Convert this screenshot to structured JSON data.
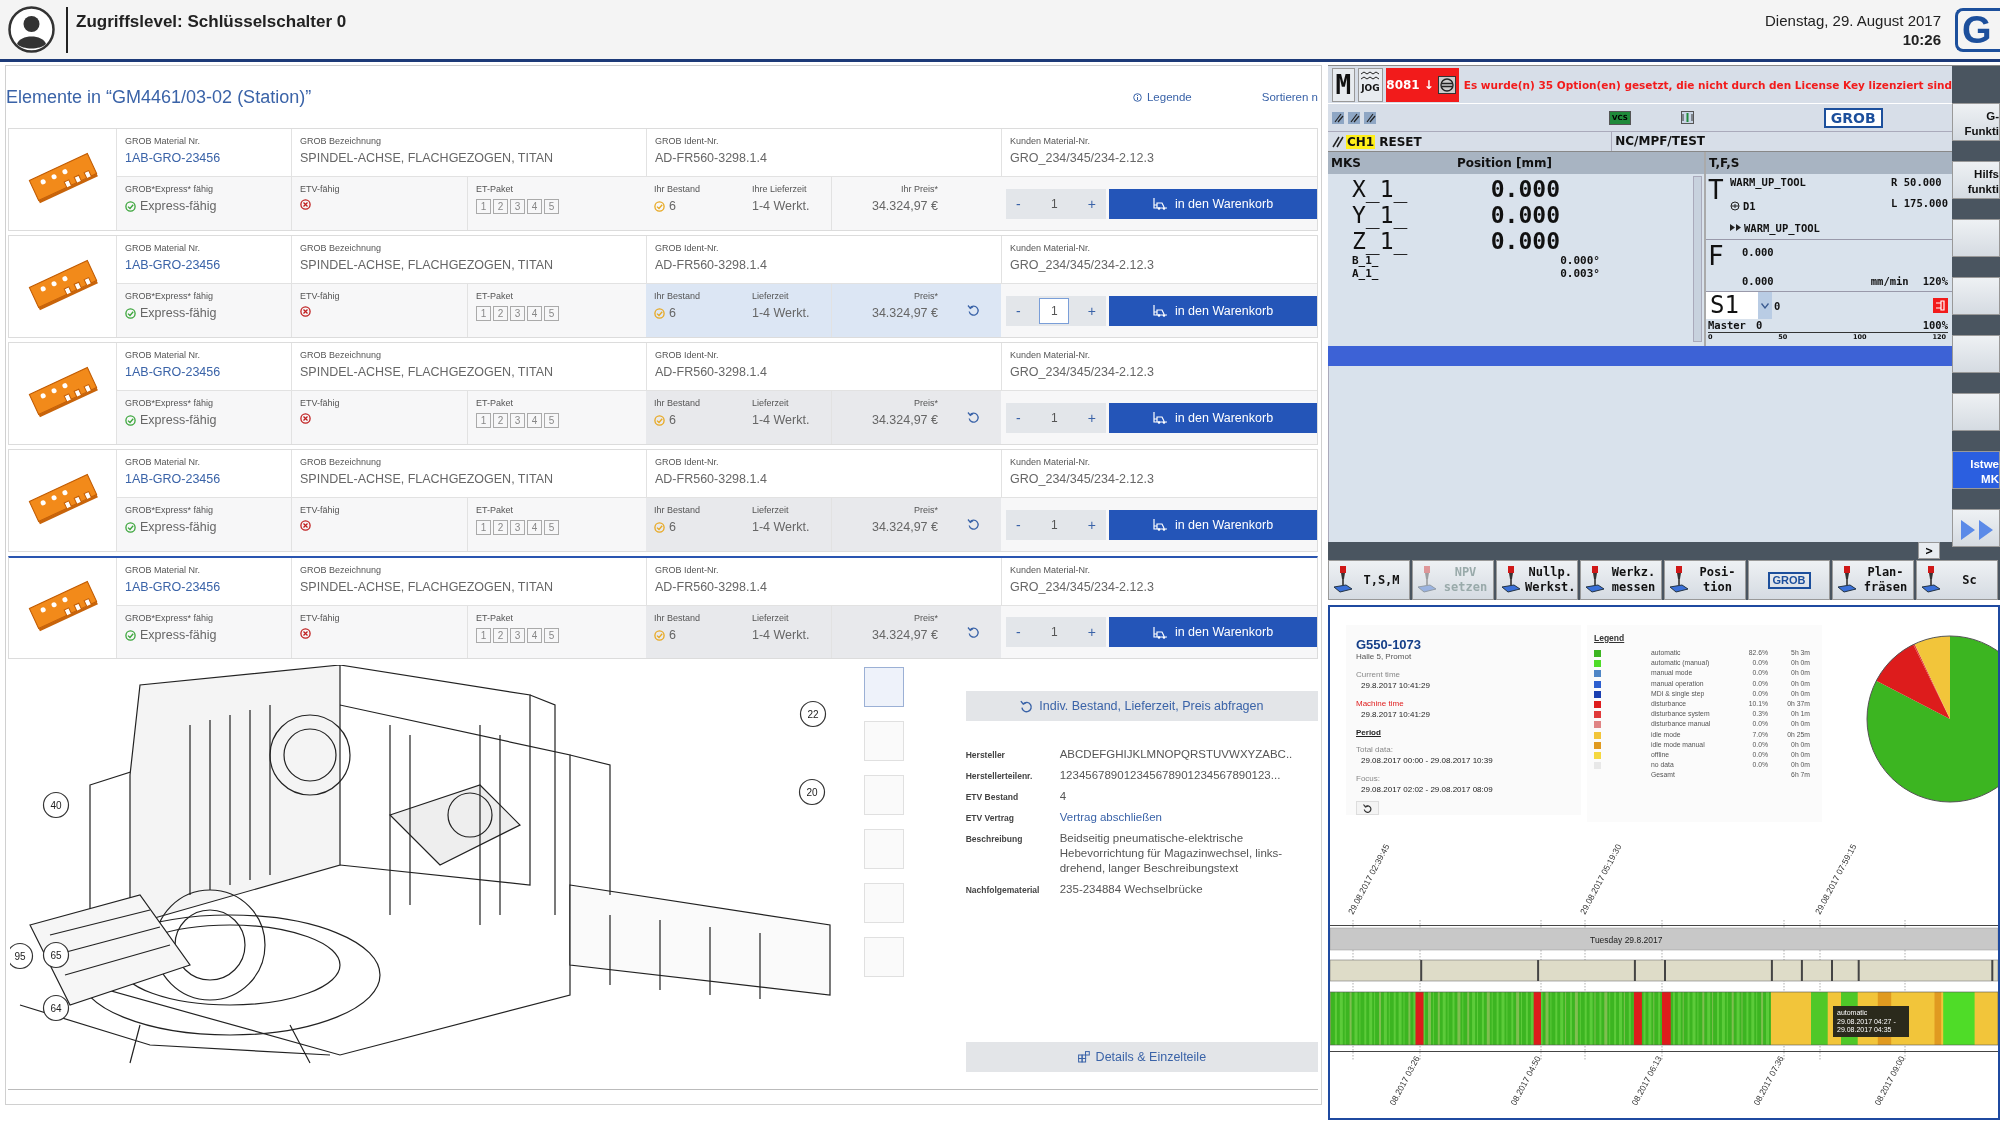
{
  "header": {
    "access_level": "Zugriffslevel: Schlüsselschalter 0",
    "date": "Dienstag, 29. August 2017",
    "time": "10:26",
    "logo": "G"
  },
  "catalog": {
    "title": "Elemente in “GM4461/03-02 (Station)”",
    "legend_link": "Legende",
    "sort_link": "Sortieren n",
    "rows": [
      {
        "kind": "own",
        "highlighted": false,
        "selected": false,
        "material_label": "GROB Material Nr.",
        "material": "1AB-GRO-23456",
        "name_label": "GROB Bezeichnung",
        "name": "SPINDEL-ACHSE, FLACHGEZOGEN, TITAN",
        "ident_label": "GROB Ident-Nr.",
        "ident": "AD-FR560-3298.1.4",
        "customer_label": "Kunden Material-Nr.",
        "customer": "GRO_234/345/234-2.12.3",
        "express_label": "GROB*Express* fähig",
        "express": "Express-fähig",
        "etv_label": "ETV-fähig",
        "etv": false,
        "package_label": "ET-Paket",
        "packages": [
          "1",
          "2",
          "3",
          "4",
          "5"
        ],
        "stock_label": "Ihr Bestand",
        "stock": "6",
        "delivery_label": "Ihre Lieferzeit",
        "delivery": "1-4 Werkt.",
        "price_label": "Ihr Preis*",
        "price": "34.324,97 €",
        "minus": "-",
        "quantity": "1",
        "plus": "+",
        "cart": "in den Warenkorb"
      },
      {
        "kind": "queried",
        "highlighted": true,
        "selected": false,
        "material_label": "GROB Material Nr.",
        "material": "1AB-GRO-23456",
        "name_label": "GROB Bezeichnung",
        "name": "SPINDEL-ACHSE, FLACHGEZOGEN, TITAN",
        "ident_label": "GROB Ident-Nr.",
        "ident": "AD-FR560-3298.1.4",
        "customer_label": "Kunden Material-Nr.",
        "customer": "GRO_234/345/234-2.12.3",
        "express_label": "GROB*Express* fähig",
        "express": "Express-fähig",
        "etv_label": "ETV-fähig",
        "etv": false,
        "package_label": "ET-Paket",
        "packages": [
          "1",
          "2",
          "3",
          "4",
          "5"
        ],
        "stock_label": "Ihr Bestand",
        "stock": "6",
        "delivery_label": "Lieferzeit",
        "delivery": "1-4 Werkt.",
        "price_label": "Preis*",
        "price": "34.324,97 €",
        "minus": "-",
        "quantity": "1",
        "plus": "+",
        "cart": "in den Warenkorb"
      },
      {
        "kind": "queried",
        "highlighted": false,
        "selected": false,
        "material_label": "GROB Material Nr.",
        "material": "1AB-GRO-23456",
        "name_label": "GROB Bezeichnung",
        "name": "SPINDEL-ACHSE, FLACHGEZOGEN, TITAN",
        "ident_label": "GROB Ident-Nr.",
        "ident": "AD-FR560-3298.1.4",
        "customer_label": "Kunden Material-Nr.",
        "customer": "GRO_234/345/234-2.12.3",
        "express_label": "GROB*Express* fähig",
        "express": "Express-fähig",
        "etv_label": "ETV-fähig",
        "etv": false,
        "package_label": "ET-Paket",
        "packages": [
          "1",
          "2",
          "3",
          "4",
          "5"
        ],
        "stock_label": "Ihr Bestand",
        "stock": "6",
        "delivery_label": "Lieferzeit",
        "delivery": "1-4 Werkt.",
        "price_label": "Preis*",
        "price": "34.324,97 €",
        "minus": "-",
        "quantity": "1",
        "plus": "+",
        "cart": "in den Warenkorb"
      },
      {
        "kind": "queried",
        "highlighted": false,
        "selected": false,
        "material_label": "GROB Material Nr.",
        "material": "1AB-GRO-23456",
        "name_label": "GROB Bezeichnung",
        "name": "SPINDEL-ACHSE, FLACHGEZOGEN, TITAN",
        "ident_label": "GROB Ident-Nr.",
        "ident": "AD-FR560-3298.1.4",
        "customer_label": "Kunden Material-Nr.",
        "customer": "GRO_234/345/234-2.12.3",
        "express_label": "GROB*Express* fähig",
        "express": "Express-fähig",
        "etv_label": "ETV-fähig",
        "etv": false,
        "package_label": "ET-Paket",
        "packages": [
          "1",
          "2",
          "3",
          "4",
          "5"
        ],
        "stock_label": "Ihr Bestand",
        "stock": "6",
        "delivery_label": "Lieferzeit",
        "delivery": "1-4 Werkt.",
        "price_label": "Preis*",
        "price": "34.324,97 €",
        "minus": "-",
        "quantity": "1",
        "plus": "+",
        "cart": "in den Warenkorb"
      },
      {
        "kind": "queried",
        "highlighted": false,
        "selected": true,
        "material_label": "GROB Material Nr.",
        "material": "1AB-GRO-23456",
        "name_label": "GROB Bezeichnung",
        "name": "SPINDEL-ACHSE, FLACHGEZOGEN, TITAN",
        "ident_label": "GROB Ident-Nr.",
        "ident": "AD-FR560-3298.1.4",
        "customer_label": "Kunden Material-Nr.",
        "customer": "GRO_234/345/234-2.12.3",
        "express_label": "GROB*Express* fähig",
        "express": "Express-fähig",
        "etv_label": "ETV-fähig",
        "etv": false,
        "package_label": "ET-Paket",
        "packages": [
          "1",
          "2",
          "3",
          "4",
          "5"
        ],
        "stock_label": "Ihr Bestand",
        "stock": "6",
        "delivery_label": "Lieferzeit",
        "delivery": "1-4 Werkt.",
        "price_label": "Preis*",
        "price": "34.324,97 €",
        "minus": "-",
        "quantity": "1",
        "plus": "+",
        "cart": "in den Warenkorb"
      }
    ],
    "callouts": [
      "22",
      "20",
      "40",
      "95",
      "65",
      "64"
    ],
    "thumbnails": [
      {
        "selected": true
      },
      {
        "selected": false
      },
      {
        "selected": false
      },
      {
        "selected": false
      },
      {
        "selected": false
      },
      {
        "selected": false
      }
    ],
    "details": {
      "query_button": "Indiv. Bestand, Lieferzeit, Preis abfragen",
      "fields": [
        {
          "kind": "text",
          "label": "Hersteller",
          "value": "ABCDEFGHIJKLMNOPQRSTUVWXYZABC.."
        },
        {
          "kind": "text",
          "label": "Herstellerteilenr.",
          "value": "123456789012345678901234567890123..."
        },
        {
          "kind": "text",
          "label": "ETV Bestand",
          "value": "4"
        },
        {
          "kind": "link",
          "label": "ETV Vertrag",
          "value": "Vertrag abschließen"
        },
        {
          "kind": "text",
          "label": "Beschreibung",
          "value": "Beidseitig pneumatische-elektrische Hebevorrichtung für Magazinwechsel, links-drehend, langer Beschreibungstext"
        },
        {
          "kind": "text",
          "label": "Nachfolgematerial",
          "value": "235-234884 Wechselbrücke"
        }
      ],
      "details_button": "Details & Einzelteile"
    }
  },
  "cnc": {
    "mode": "M",
    "jog": "JOG",
    "alarm_number": "8081",
    "alarm_arrow": "↓",
    "alarm_message": "Es wurde(n) 35 Option(en) gesetzt, die nicht durch den License Key lizenziert sind",
    "vcs": "VCS",
    "brand": "GROB",
    "channel": "CH1",
    "channel_state": "RESET",
    "program": "NC/MPF/TEST",
    "axes_header": "MKS",
    "position_header": "Position [mm]",
    "axes": [
      {
        "kind": "large",
        "name": "X_1_",
        "value": "0.000"
      },
      {
        "kind": "large",
        "name": "Y_1_",
        "value": "0.000"
      },
      {
        "kind": "large",
        "name": "Z_1_",
        "value": "0.000"
      },
      {
        "kind": "small",
        "name": "B_1_",
        "value": "0.000°"
      },
      {
        "kind": "small",
        "name": "A_1_",
        "value": "0.003°"
      }
    ],
    "tfs_header": "T,F,S",
    "tool_letter": "T",
    "tool_name": "WARM_UP_TOOL",
    "tool_radius": "R 50.000",
    "tool_edge": "D1",
    "tool_length": "L 175.000",
    "tool_next": "WARM_UP_TOOL",
    "feed_letter": "F",
    "feed_value": "0.000",
    "feed_rate": "0.000",
    "feed_unit": "mm/min",
    "feed_override": "120%",
    "spindle": "S1",
    "spindle_speed": "0",
    "spindle_master": "Master",
    "spindle_master_value": "0",
    "spindle_override": "100%",
    "spindle_scale": [
      "0",
      "50",
      "100",
      "120"
    ],
    "more": ">",
    "softkeys": [
      {
        "kind": "tool",
        "label": "T,S,M",
        "disabled": false
      },
      {
        "kind": "tool",
        "label": "NPV\nsetzen",
        "disabled": true
      },
      {
        "kind": "tool",
        "label": "Nullp.\nWerkst.",
        "disabled": false
      },
      {
        "kind": "tool",
        "label": "Werkz.\nmessen",
        "disabled": false
      },
      {
        "kind": "tool",
        "label": "Posi-\ntion",
        "disabled": false
      },
      {
        "kind": "logo",
        "label": "GROB",
        "disabled": false
      },
      {
        "kind": "tool",
        "label": "Plan-\nfräsen",
        "disabled": false
      },
      {
        "kind": "tool",
        "label": "Sc",
        "disabled": false
      }
    ],
    "side_keys": [
      {
        "kind": "text",
        "label": "G-\nFunkti",
        "selected": false
      },
      {
        "kind": "text",
        "label": "Hilfs\nfunkti",
        "selected": false
      },
      {
        "kind": "text",
        "selected": false
      },
      {
        "kind": "text",
        "selected": false
      },
      {
        "kind": "text",
        "selected": false
      },
      {
        "kind": "text",
        "selected": false
      },
      {
        "kind": "text",
        "label": "Istwe\nMK",
        "selected": true
      },
      {
        "kind": "arrow",
        "selected": false
      }
    ]
  },
  "dashboard": {
    "machine": "G550-1073",
    "location": "Halle 5, Promot",
    "current_label": "Current time",
    "current": "29.8.2017 10:41:29",
    "machine_time_label": "Machine time",
    "machine_time": "29.8.2017 10:41:29",
    "period_label": "Period",
    "total_label": "Total data:",
    "total": "29.08.2017 00:00 - 29.08.2017 10:39",
    "focus_label": "Focus:",
    "focus": "29.08.2017 02:02 - 29.08.2017 08:09",
    "legend_title": "Legend",
    "legend": [
      {
        "color": "#3cb521",
        "label": "automatic",
        "share": "82.6%",
        "duration": "5h 3m"
      },
      {
        "color": "#4fdc28",
        "label": "automatic (manual)",
        "share": "0.0%",
        "duration": "0h 0m"
      },
      {
        "color": "#4f86c6",
        "label": "manual mode",
        "share": "0.0%",
        "duration": "0h 0m"
      },
      {
        "color": "#2d5fcf",
        "label": "manual operation",
        "share": "0.0%",
        "duration": "0h 0m"
      },
      {
        "color": "#1a3fb0",
        "label": "MDI & single step",
        "share": "0.0%",
        "duration": "0h 0m"
      },
      {
        "color": "#dd1c1c",
        "label": "disturbance",
        "share": "10.1%",
        "duration": "0h 37m"
      },
      {
        "color": "#e03a3a",
        "label": "disturbance system",
        "share": "0.3%",
        "duration": "0h 1m"
      },
      {
        "color": "#e08585",
        "label": "disturbance manual",
        "share": "0.0%",
        "duration": "0h 0m"
      },
      {
        "color": "#f2c53a",
        "label": "idle mode",
        "share": "7.0%",
        "duration": "0h 25m"
      },
      {
        "color": "#e09a20",
        "label": "idle mode manual",
        "share": "0.0%",
        "duration": "0h 0m"
      },
      {
        "color": "#f5d840",
        "label": "offline",
        "share": "0.0%",
        "duration": "0h 0m"
      },
      {
        "color": "#e8e8e8",
        "label": "no data",
        "share": "0.0%",
        "duration": "0h 0m"
      },
      {
        "label": "Gesamt",
        "duration": "6h 7m"
      }
    ],
    "chart_data": {
      "type": "pie",
      "values": [
        82.6,
        0,
        0,
        0,
        0,
        10.1,
        0.3,
        0,
        7.0,
        0,
        0,
        0
      ]
    },
    "timeline": {
      "top_labels": [
        "29.08.2017 02:39:45",
        "29.08.2017 05:19:30",
        "29.08.2017 07:59:15"
      ],
      "day": "Tuesday 29.8.2017",
      "bottom_labels": [
        "08.2017 03:26",
        "08.2017 04:50",
        "08.2017 06:13",
        "08.2017 07:36",
        "08.2017 09:00"
      ],
      "tooltip": "automatic\n29.08.2017 04:27 -\n29.08.2017 04:35"
    }
  }
}
